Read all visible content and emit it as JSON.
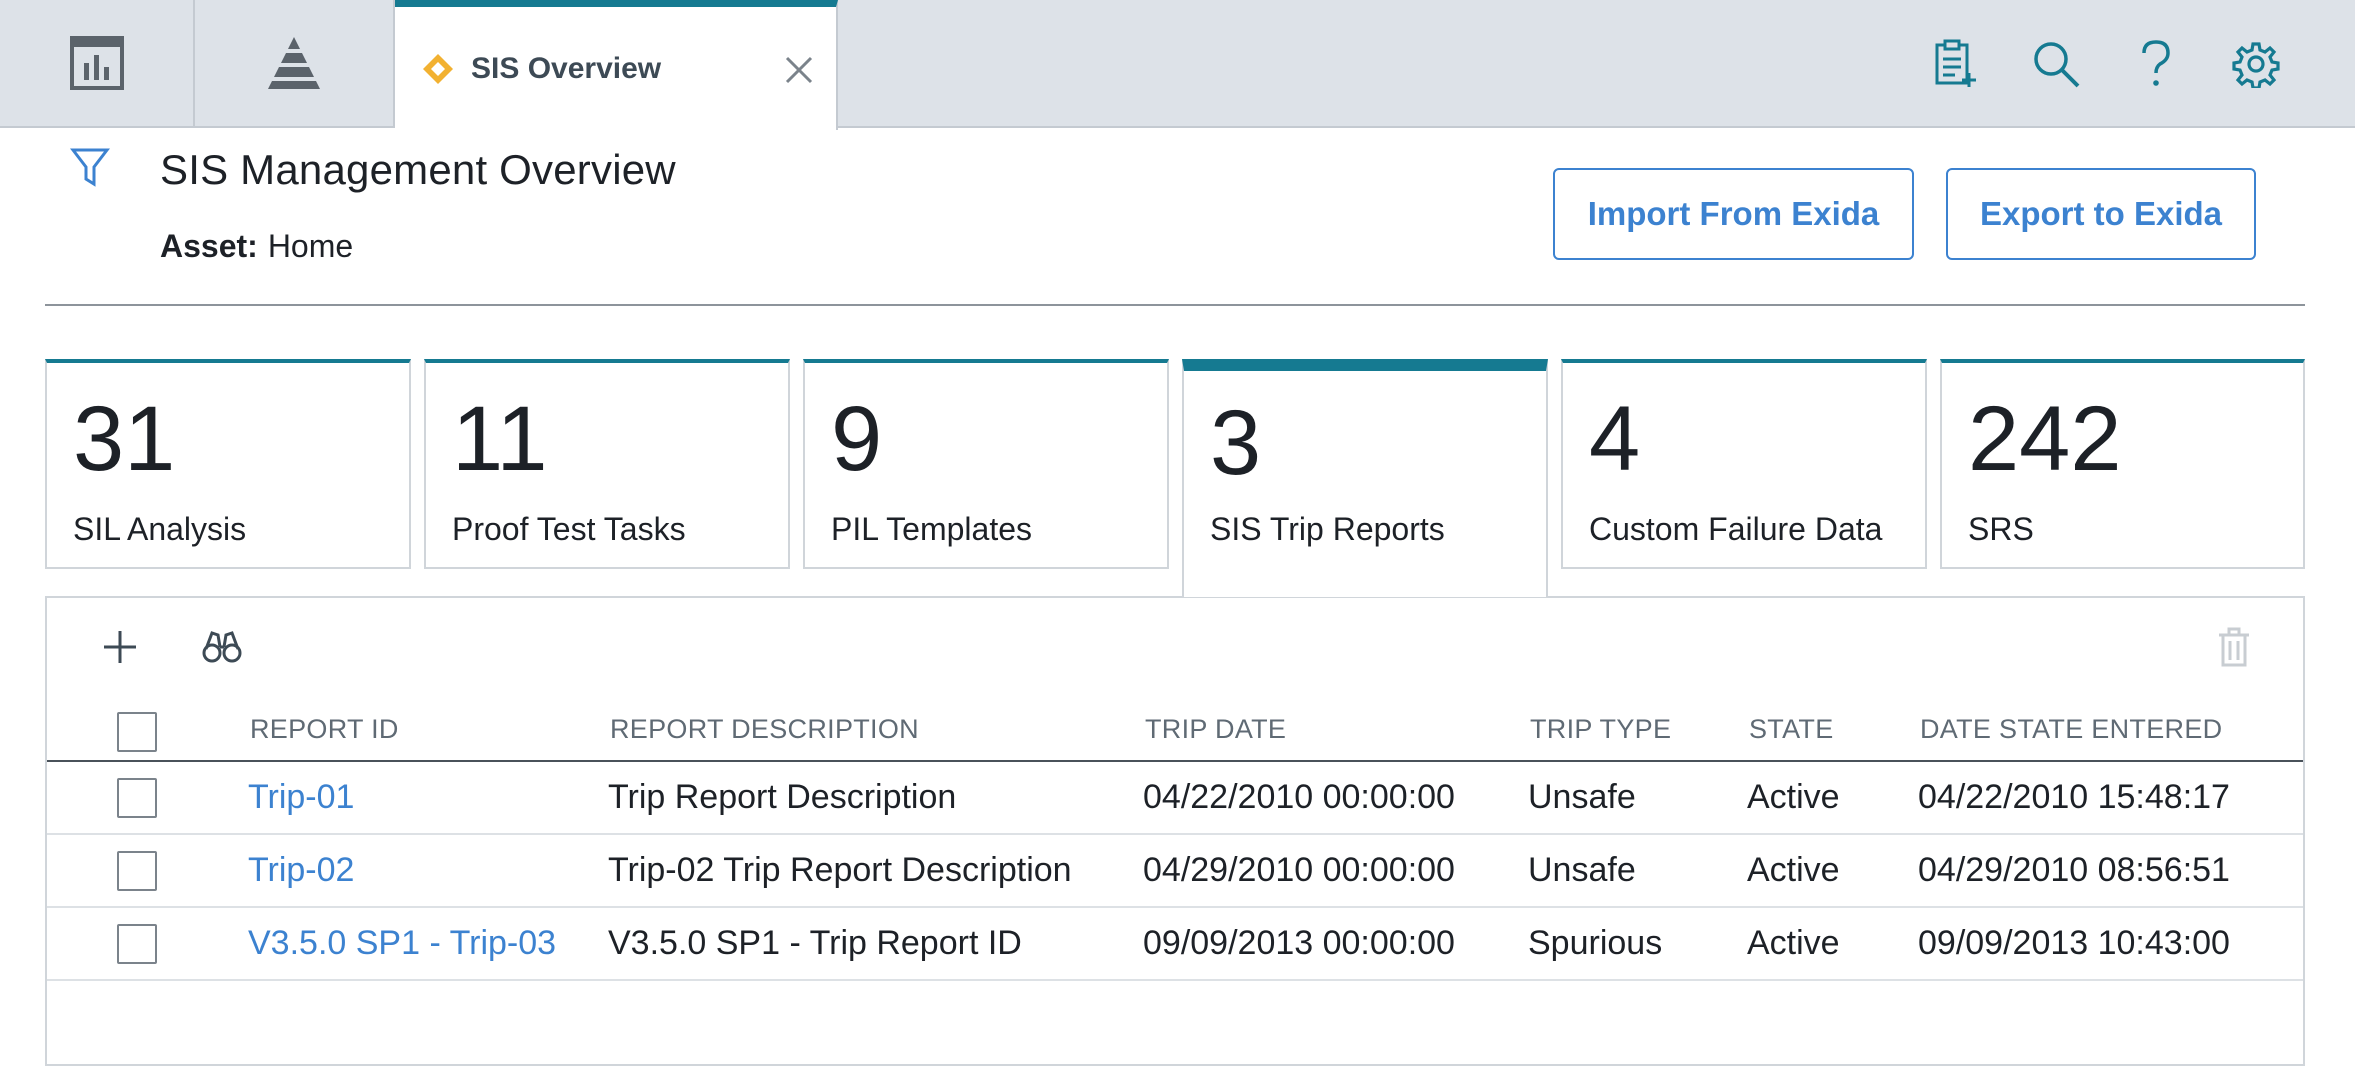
{
  "tabs": {
    "dashboard_icon": "dashboard-icon",
    "pyramid_icon": "pyramid-icon",
    "active": {
      "label": "SIS Overview",
      "icon": "diamond-icon",
      "icon_color": "#f2b131"
    }
  },
  "top_actions": [
    "clipboard-add-icon",
    "search-icon",
    "help-icon",
    "gear-icon"
  ],
  "header": {
    "title": "SIS Management Overview",
    "asset_label": "Asset:",
    "asset_value": "Home",
    "import_button": "Import From Exida",
    "export_button": "Export to Exida"
  },
  "kpis": [
    {
      "value": "31",
      "label": "SIL Analysis"
    },
    {
      "value": "11",
      "label": "Proof Test Tasks"
    },
    {
      "value": "9",
      "label": "PIL Templates"
    },
    {
      "value": "3",
      "label": "SIS Trip Reports",
      "active": true
    },
    {
      "value": "4",
      "label": "Custom Failure Data"
    },
    {
      "value": "242",
      "label": "SRS"
    }
  ],
  "table": {
    "columns": [
      "REPORT ID",
      "REPORT DESCRIPTION",
      "TRIP DATE",
      "TRIP TYPE",
      "STATE",
      "DATE STATE ENTERED"
    ],
    "rows": [
      {
        "report_id": "Trip-01",
        "description": "Trip Report Description",
        "trip_date": "04/22/2010 00:00:00",
        "trip_type": "Unsafe",
        "state": "Active",
        "date_state_entered": "04/22/2010 15:48:17"
      },
      {
        "report_id": "Trip-02",
        "description": "Trip-02 Trip Report Description",
        "trip_date": "04/29/2010 00:00:00",
        "trip_type": "Unsafe",
        "state": "Active",
        "date_state_entered": "04/29/2010 08:56:51"
      },
      {
        "report_id": "V3.5.0 SP1 - Trip-03",
        "description": "V3.5.0 SP1 - Trip Report ID",
        "trip_date": "09/09/2013 00:00:00",
        "trip_type": "Spurious",
        "state": "Active",
        "date_state_entered": "09/09/2013 10:43:00"
      }
    ]
  },
  "colors": {
    "accent": "#157a91",
    "link": "#3c82d0",
    "tab_bg": "#dde2e8"
  }
}
